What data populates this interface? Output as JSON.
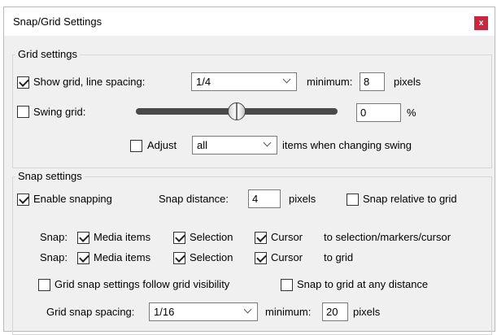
{
  "window": {
    "title": "Snap/Grid Settings",
    "close_label": "x"
  },
  "grid_settings": {
    "title": "Grid settings",
    "show_grid": {
      "label": "Show grid, line spacing:",
      "checked": true
    },
    "line_spacing": "1/4",
    "minimum_label": "minimum:",
    "minimum_value": "8",
    "pixels_label": "pixels",
    "swing_grid": {
      "label": "Swing grid:",
      "checked": false
    },
    "swing_value": "0",
    "swing_percent": "%",
    "swing_slider_fraction": 0.5,
    "adjust": {
      "label": "Adjust",
      "checked": false
    },
    "adjust_option": "all",
    "adjust_suffix": "items when changing swing"
  },
  "snap_settings": {
    "title": "Snap settings",
    "enable_snapping": {
      "label": "Enable snapping",
      "checked": true
    },
    "snap_distance_label": "Snap distance:",
    "snap_distance_value": "4",
    "pixels_label": "pixels",
    "snap_relative": {
      "label": "Snap relative to grid",
      "checked": false
    },
    "rows": [
      {
        "prefix": "Snap:",
        "media": "Media items",
        "selection": "Selection",
        "cursor": "Cursor",
        "target": "to selection/markers/cursor"
      },
      {
        "prefix": "Snap:",
        "media": "Media items",
        "selection": "Selection",
        "cursor": "Cursor",
        "target": "to grid"
      }
    ],
    "follow_visibility": {
      "label": "Grid snap settings follow grid visibility",
      "checked": false
    },
    "any_distance": {
      "label": "Snap to grid at any distance",
      "checked": false
    },
    "spacing_label": "Grid snap spacing:",
    "spacing_value": "1/16",
    "minimum_label": "minimum:",
    "minimum_value": "20",
    "pixels_label2": "pixels"
  }
}
